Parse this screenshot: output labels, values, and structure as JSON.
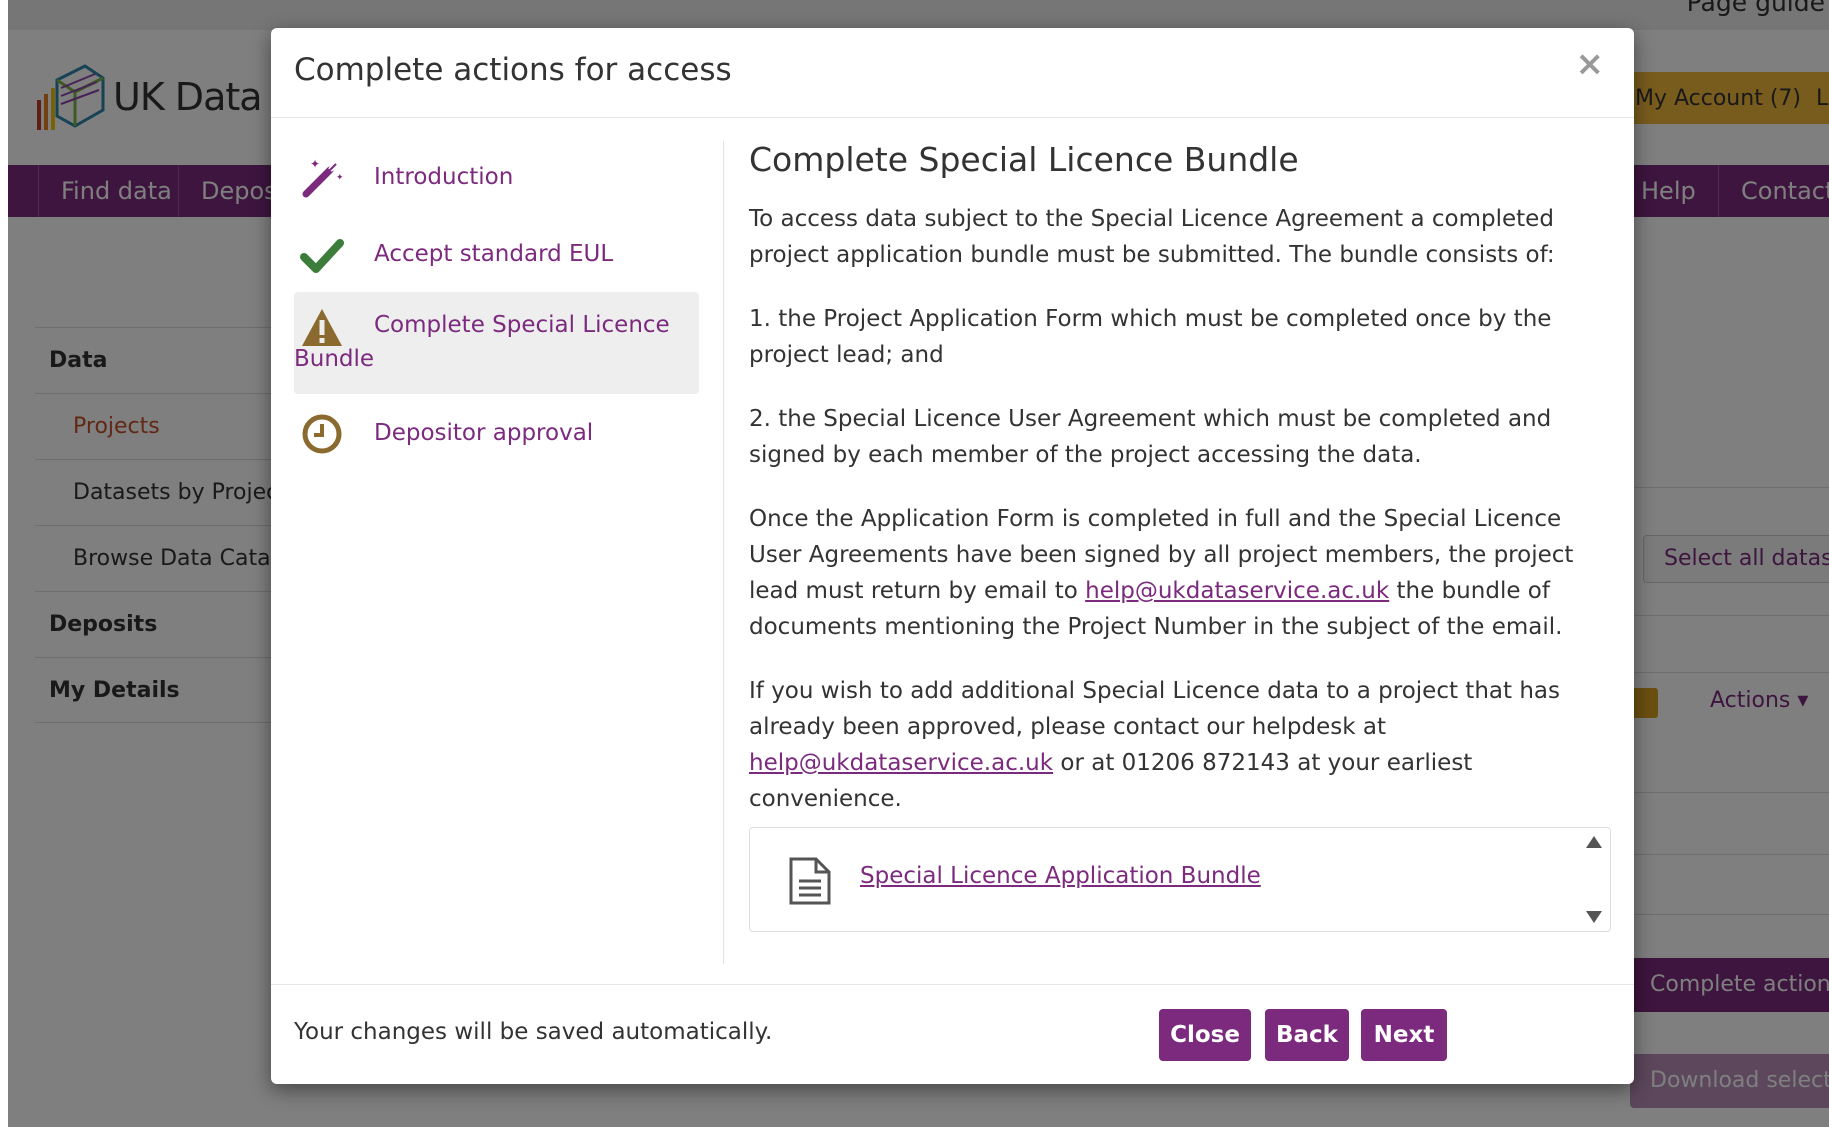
{
  "background": {
    "page_guide": "Page guide",
    "logo_text": "UK Data Service",
    "account": "My Account (7)",
    "logout": "Logout",
    "nav": [
      "Find data",
      "Deposit data",
      "Help",
      "Contact"
    ],
    "side_menu": {
      "data_header": "Data",
      "projects": "Projects",
      "datasets_by_project": "Datasets by Project",
      "browse_catalogue": "Browse Data Catalogue",
      "deposits": "Deposits",
      "my_details": "My Details"
    },
    "select_all": "Select all datasets",
    "actions": "Actions ▾",
    "complete_actions": "Complete actions",
    "download_selected": "Download selected"
  },
  "modal": {
    "title": "Complete actions for access",
    "close_glyph": "×",
    "steps": [
      {
        "label": "Introduction",
        "icon": "magic-wand-icon",
        "color": "#7b2a7e"
      },
      {
        "label": "Accept standard EUL",
        "icon": "checkmark-icon",
        "color": "#3c7d3c"
      },
      {
        "label": "Complete Special Licence Bundle",
        "icon": "warning-icon",
        "color": "#8a6a2e"
      },
      {
        "label": "Depositor approval",
        "icon": "clock-icon",
        "color": "#8a6a2e"
      }
    ],
    "content": {
      "heading": "Complete Special Licence Bundle",
      "p1": "To access data subject to the Special Licence Agreement a completed project application bundle must be submitted. The bundle consists of:",
      "p2": "1. the Project Application Form which must be completed once by the project lead; and",
      "p3": "2. the Special Licence User Agreement which must be completed and signed by each member of the project accessing the data.",
      "p4_before": "Once the Application Form is completed in full and the Special Licence User Agreements have been signed by all project members, the project lead must return by email to ",
      "p4_link": "help@ukdataservice.ac.uk",
      "p4_after": " the bundle of documents mentioning the Project Number in the subject of the email.",
      "p5_before": "If you wish to add additional Special Licence data to a project that has already been approved, please contact our helpdesk at ",
      "p5_link": "help@ukdataservice.ac.uk",
      "p5_after": " or at 01206 872143 at your earliest convenience.",
      "attachment": "Special Licence Application Bundle"
    },
    "footer": {
      "note": "Your changes will be saved automatically.",
      "close": "Close",
      "back": "Back",
      "next": "Next"
    }
  }
}
